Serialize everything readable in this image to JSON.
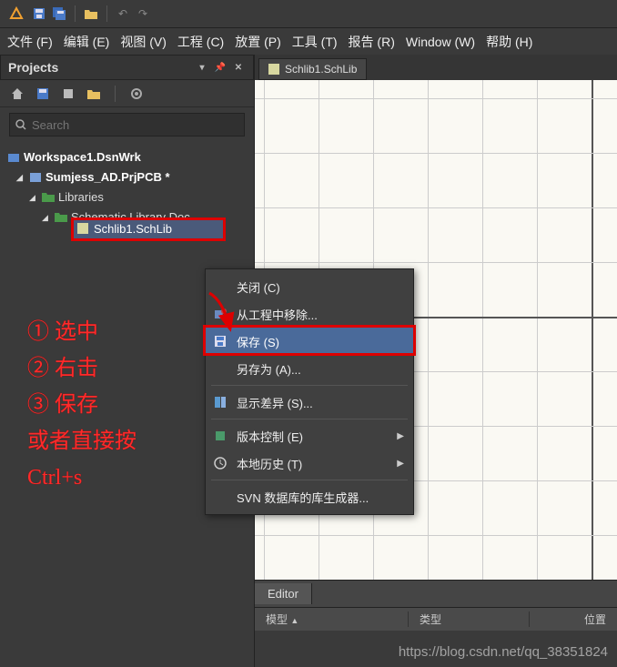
{
  "menu": {
    "file": "文件 (F)",
    "edit": "编辑 (E)",
    "view": "视图 (V)",
    "project": "工程 (C)",
    "place": "放置 (P)",
    "tools": "工具 (T)",
    "report": "报告 (R)",
    "window": "Window (W)",
    "help": "帮助 (H)"
  },
  "panel": {
    "title": "Projects",
    "search_placeholder": "Search"
  },
  "tree": {
    "workspace": "Workspace1.DsnWrk",
    "project": "Sumjess_AD.PrjPCB *",
    "folder1": "Libraries",
    "folder2": "Schematic Library Doc",
    "file": "Schlib1.SchLib"
  },
  "tab": {
    "name": "Schlib1.SchLib"
  },
  "context_menu": {
    "close": "关闭 (C)",
    "remove": "从工程中移除...",
    "save": "保存 (S)",
    "save_as": "另存为 (A)...",
    "show_diff": "显示差异 (S)...",
    "version_ctrl": "版本控制 (E)",
    "local_history": "本地历史 (T)",
    "svn_gen": "SVN 数据库的库生成器..."
  },
  "editor": {
    "tab": "Editor",
    "col_model": "模型",
    "col_type": "类型",
    "col_pos": "位置"
  },
  "annotation": {
    "l1": "① 选中",
    "l2": "② 右击",
    "l3": "③ 保存",
    "l4": "或者直接按",
    "l5": "Ctrl+s"
  },
  "watermark": "https://blog.csdn.net/qq_38351824"
}
